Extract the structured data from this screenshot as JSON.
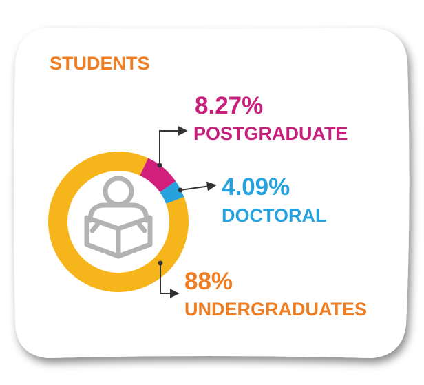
{
  "title": "STUDENTS",
  "chart_data": {
    "type": "pie",
    "title": "STUDENTS",
    "series": [
      {
        "name": "POSTGRADUATE",
        "value_label": "8.27%",
        "value": 8.27,
        "color": "#d21f7c"
      },
      {
        "name": "DOCTORAL",
        "value_label": "4.09%",
        "value": 4.09,
        "color": "#27a2dc"
      },
      {
        "name": "UNDERGRADUATES",
        "value_label": "88%",
        "value": 88,
        "color": "#f7b51c"
      }
    ]
  },
  "colors": {
    "title": "#ef7d22",
    "postgraduate": "#c71f7b",
    "doctoral": "#27a2dc",
    "undergraduates": "#ef7d22",
    "icon": "#b3b3b3",
    "arrow": "#333333"
  },
  "icon": "person-reading-icon"
}
